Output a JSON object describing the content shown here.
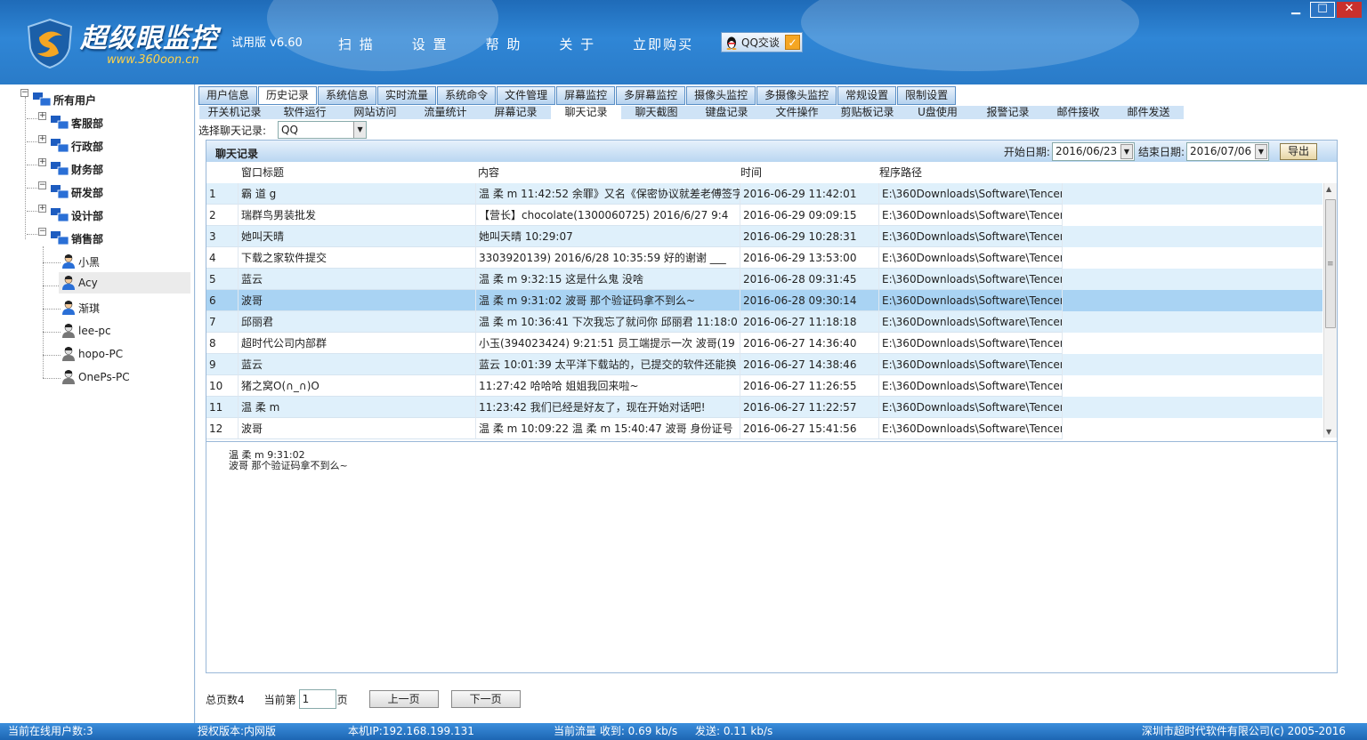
{
  "app": {
    "name": "超级眼监控",
    "url": "www.360oon.cn",
    "version": "试用版 v6.60"
  },
  "nav": [
    "扫 描",
    "设 置",
    "帮 助",
    "关 于",
    "立即购买"
  ],
  "qq": {
    "label": "QQ交谈"
  },
  "window": {
    "minimize": "▁",
    "maximize": "☐",
    "close": "✕"
  },
  "tree": {
    "root": "所有用户",
    "groups": [
      "客服部",
      "行政部",
      "财务部",
      "研发部",
      "设计部",
      "销售部"
    ],
    "users": [
      "小黑",
      "Acy",
      "渐琪",
      "lee-pc",
      "hopo-PC",
      "OnePs-PC"
    ]
  },
  "tabs_main": [
    "用户信息",
    "历史记录",
    "系统信息",
    "实时流量",
    "系统命令",
    "文件管理",
    "屏幕监控",
    "多屏幕监控",
    "摄像头监控",
    "多摄像头监控",
    "常规设置",
    "限制设置"
  ],
  "tabs_sub": [
    "开关机记录",
    "软件运行",
    "网站访问",
    "流量统计",
    "屏幕记录",
    "聊天记录",
    "聊天截图",
    "键盘记录",
    "文件操作",
    "剪贴板记录",
    "U盘使用",
    "报警记录",
    "邮件接收",
    "邮件发送"
  ],
  "selector": {
    "label": "选择聊天记录:",
    "value": "QQ"
  },
  "panel": {
    "title": "聊天记录",
    "start_label": "开始日期:",
    "start_date": "2016/06/23",
    "end_label": "结束日期:",
    "end_date": "2016/07/06",
    "export_label": "导出",
    "columns": {
      "title": "窗口标题",
      "content": "内容",
      "time": "时间",
      "path": "程序路径"
    },
    "rows": [
      {
        "idx": "1",
        "title": "霸 道 g",
        "content": "温 柔 m 11:42:52 余罪》又名《保密协议就差老傅签字",
        "time": "2016-06-29 11:42:01",
        "path": "E:\\360Downloads\\Software\\Tencent"
      },
      {
        "idx": "2",
        "title": "瑞群鸟男装批发",
        "content": "【营长】chocolate(1300060725) 2016/6/27 9:4",
        "time": "2016-06-29 09:09:15",
        "path": "E:\\360Downloads\\Software\\Tencent"
      },
      {
        "idx": "3",
        "title": "她叫天晴",
        "content": "她叫天晴 10:29:07",
        "time": "2016-06-29 10:28:31",
        "path": "E:\\360Downloads\\Software\\Tencent"
      },
      {
        "idx": "4",
        "title": "下载之家软件提交",
        "content": "3303920139) 2016/6/28 10:35:59 好的谢谢 ___",
        "time": "2016-06-29 13:53:00",
        "path": "E:\\360Downloads\\Software\\Tencent"
      },
      {
        "idx": "5",
        "title": "蓝云",
        "content": "温 柔 m 9:32:15 这是什么鬼 没啥",
        "time": "2016-06-28 09:31:45",
        "path": "E:\\360Downloads\\Software\\Tencent"
      },
      {
        "idx": "6",
        "title": "波哥",
        "content": "温 柔 m 9:31:02 波哥 那个验证码拿不到么~",
        "time": "2016-06-28 09:30:14",
        "path": "E:\\360Downloads\\Software\\Tencent"
      },
      {
        "idx": "7",
        "title": "邱丽君",
        "content": "温 柔 m 10:36:41 下次我忘了就问你 邱丽君 11:18:0",
        "time": "2016-06-27 11:18:18",
        "path": "E:\\360Downloads\\Software\\Tencent"
      },
      {
        "idx": "8",
        "title": "超时代公司内部群",
        "content": "小玉(394023424) 9:21:51 员工端提示一次 波哥(19",
        "time": "2016-06-27 14:36:40",
        "path": "E:\\360Downloads\\Software\\Tencent"
      },
      {
        "idx": "9",
        "title": "蓝云",
        "content": "蓝云 10:01:39 太平洋下载站的，已提交的软件还能换",
        "time": "2016-06-27 14:38:46",
        "path": "E:\\360Downloads\\Software\\Tencent"
      },
      {
        "idx": "10",
        "title": "猪之窝O(∩_∩)O",
        "content": "11:27:42 哈哈哈 姐姐我回来啦~",
        "time": "2016-06-27 11:26:55",
        "path": "E:\\360Downloads\\Software\\Tencent"
      },
      {
        "idx": "11",
        "title": "温 柔 m",
        "content": "11:23:42 我们已经是好友了，现在开始对话吧!",
        "time": "2016-06-27 11:22:57",
        "path": "E:\\360Downloads\\Software\\Tencent"
      },
      {
        "idx": "12",
        "title": "波哥",
        "content": "温 柔 m 10:09:22 温 柔 m 15:40:47 波哥 身份证号",
        "time": "2016-06-27 15:41:56",
        "path": "E:\\360Downloads\\Software\\Tencent"
      }
    ],
    "selected_row": 6,
    "detail_line1": "温 柔 m  9:31:02",
    "detail_line2": "波哥 那个验证码拿不到么~"
  },
  "pager": {
    "total": "总页数4",
    "current_label": "当前第",
    "current": "1",
    "page_unit": "页",
    "prev": "上一页",
    "next": "下一页"
  },
  "status": {
    "online": "当前在线用户数:3",
    "license": "授权版本:内网版",
    "ip": "本机IP:192.168.199.131",
    "traffic": "当前流量 收到: 0.69 kb/s",
    "send": "发送: 0.11 kb/s",
    "copyright": "深圳市超时代软件有限公司(c) 2005-2016"
  },
  "colors": {
    "accent": "#2a7bc8",
    "row_alt": "#dff0fb",
    "row_selected": "#a9d3f3"
  }
}
